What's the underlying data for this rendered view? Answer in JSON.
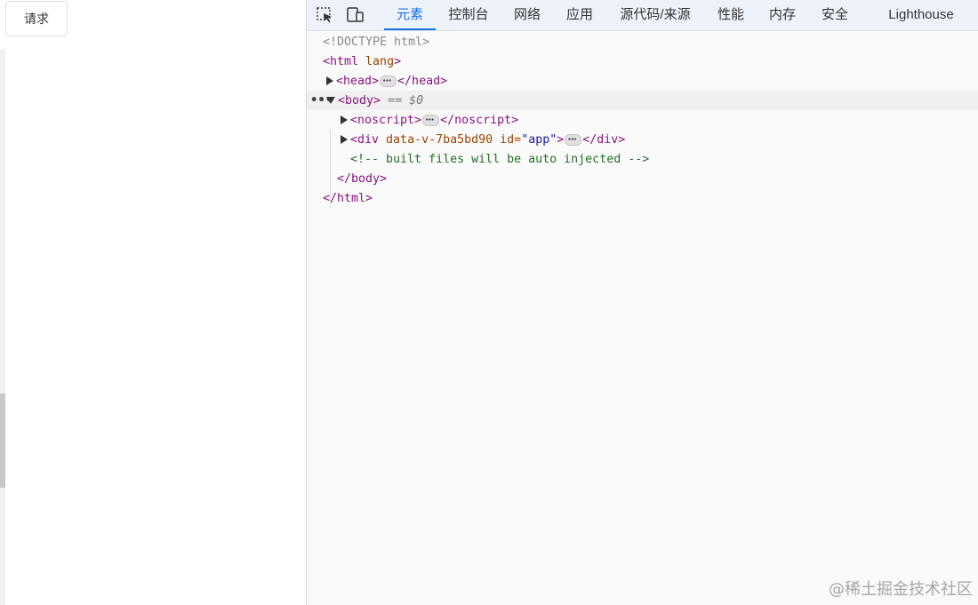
{
  "page": {
    "request_button_label": "请求"
  },
  "devtools": {
    "tabs": [
      {
        "label": "元素",
        "active": true
      },
      {
        "label": "控制台"
      },
      {
        "label": "网络"
      },
      {
        "label": "应用"
      },
      {
        "label": "源代码/来源"
      },
      {
        "label": "性能"
      },
      {
        "label": "内存"
      },
      {
        "label": "安全"
      },
      {
        "label": "Lighthouse"
      }
    ],
    "toolbar_icons": [
      "inspect-element-icon",
      "device-toolbar-icon"
    ],
    "dom": {
      "doctype": "<!DOCTYPE html>",
      "html_open": "<html",
      "html_attr": "lang",
      "html_close_bracket": ">",
      "head_open": "<head>",
      "head_close": "</head>",
      "body_open": "<body>",
      "body_selected_marker": "== $0",
      "noscript_open": "<noscript>",
      "noscript_close": "</noscript>",
      "div_open": "<div",
      "div_attr1": "data-v-7ba5bd90",
      "div_attr2_name": "id=",
      "div_attr2_value": "\"app\"",
      "div_gt": ">",
      "div_close": "</div>",
      "comment": "<!-- built files will be auto injected -->",
      "body_close": "</body>",
      "html_close": "</html>"
    },
    "gutter_dots": "•••"
  },
  "watermark": "@稀土掘金技术社区",
  "colors": {
    "accent": "#1a73e8",
    "tag": "#881280",
    "attr": "#994500",
    "attr_value": "#1a1aa6",
    "comment": "#236e25"
  }
}
